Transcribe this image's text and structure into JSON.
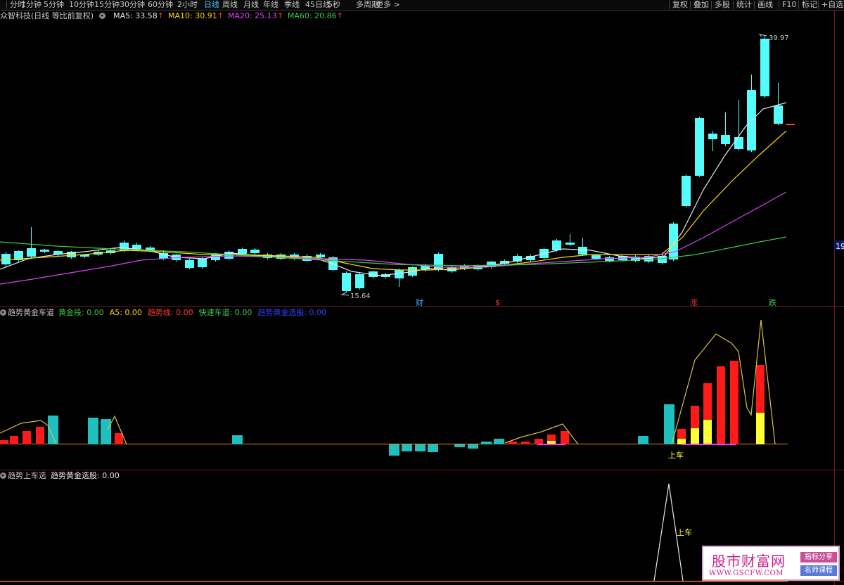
{
  "toolbar": {
    "left_items": [
      "分时",
      "1分钟",
      "5分钟",
      "10分钟",
      "15分钟",
      "30分钟",
      "60分钟",
      "2小时",
      "日线",
      "周线",
      "月线",
      "年线",
      "季线",
      "45日线",
      "5秒",
      "多周期",
      "更多 >"
    ],
    "active_item": "日线",
    "right_items": [
      "复权",
      "叠加",
      "多股",
      "统计",
      "画线",
      "F10",
      "标记",
      "+自选"
    ]
  },
  "main_panel": {
    "stock_name": "众智科技",
    "mode": "(日线 等比前复权)",
    "ma": [
      {
        "label": "MA5: 33.58",
        "arrow": "↑",
        "color": "#e8e8e8"
      },
      {
        "label": "MA10: 30.91",
        "arrow": "↑",
        "color": "#ffd700"
      },
      {
        "label": "MA20: 25.13",
        "arrow": "↑",
        "color": "#e040fb"
      },
      {
        "label": "MA60: 20.86",
        "arrow": "↑",
        "color": "#3ec94a"
      }
    ],
    "high_label": "39.97",
    "low_label": "15.64",
    "markers": [
      {
        "text": "财",
        "color": "#4a9dff"
      },
      {
        "text": "$",
        "color": "#e03a3a"
      },
      {
        "text": "涨",
        "color": "#e03a3a"
      },
      {
        "text": "跌",
        "color": "#3ec94a"
      }
    ],
    "right_axis_label": "19"
  },
  "indicator_panel": {
    "name": "趋势黄金车道",
    "values": [
      {
        "label": "黄金段: 0.00",
        "color": "#3ec94a"
      },
      {
        "label": "A5: 0.00",
        "color": "#ffd700"
      },
      {
        "label": "趋势线: 0.00",
        "color": "#ff3b3b"
      },
      {
        "label": "快速车道: 0.00",
        "color": "#3ec94a"
      },
      {
        "label": "趋势黄金选股: 0.00",
        "color": "#2f3fff"
      }
    ],
    "signal_text": "上车"
  },
  "selector_panel": {
    "name": "趋势上车选",
    "value_label": "趋势黄金选股: 0.00",
    "signal_text": "上车"
  },
  "watermark": {
    "title": "股市财富网",
    "url": "WWW.GSCFW.COM",
    "tag1": "指标分享",
    "tag2": "名师课程"
  }
}
